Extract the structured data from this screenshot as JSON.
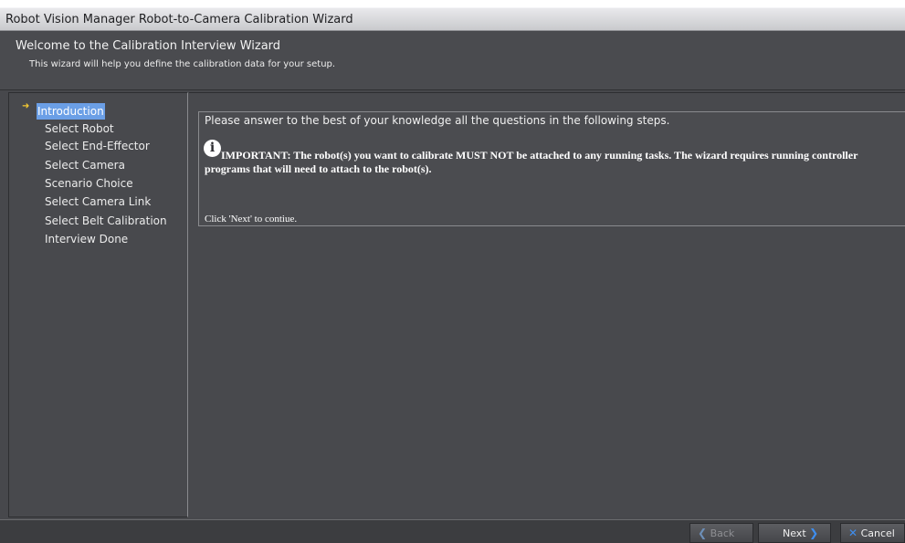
{
  "window": {
    "title": "Robot Vision Manager Robot-to-Camera Calibration Wizard"
  },
  "header": {
    "title": "Welcome to the Calibration Interview Wizard",
    "subtitle": "This wizard will help you define the calibration data for your setup."
  },
  "steps": [
    {
      "label": "Introduction",
      "active": true
    },
    {
      "label": "Select Robot",
      "active": false
    },
    {
      "label": "Select End-Effector",
      "active": false
    },
    {
      "label": "Select Camera",
      "active": false
    },
    {
      "label": "Scenario Choice",
      "active": false
    },
    {
      "label": "Select Camera Link",
      "active": false
    },
    {
      "label": "Select Belt Calibration",
      "active": false
    },
    {
      "label": "Interview Done",
      "active": false
    }
  ],
  "content": {
    "intro": "Please answer to the best of your knowledge all the questions in the following steps.",
    "important": "IMPORTANT: The robot(s) you want to calibrate MUST NOT be attached to any running tasks. The wizard requires running controller programs that will need to attach to the robot(s).",
    "click_next": "Click 'Next' to contiue."
  },
  "buttons": {
    "back": {
      "label": "Back",
      "enabled": false,
      "icon": "chevron-left-icon"
    },
    "next": {
      "label": "Next",
      "enabled": true,
      "icon": "chevron-right-icon"
    },
    "cancel": {
      "label": "Cancel",
      "enabled": true,
      "icon": "close-icon"
    }
  },
  "colors": {
    "accent": "#6b9fe6",
    "background": "#47484c",
    "arrow": "#f2c832"
  }
}
